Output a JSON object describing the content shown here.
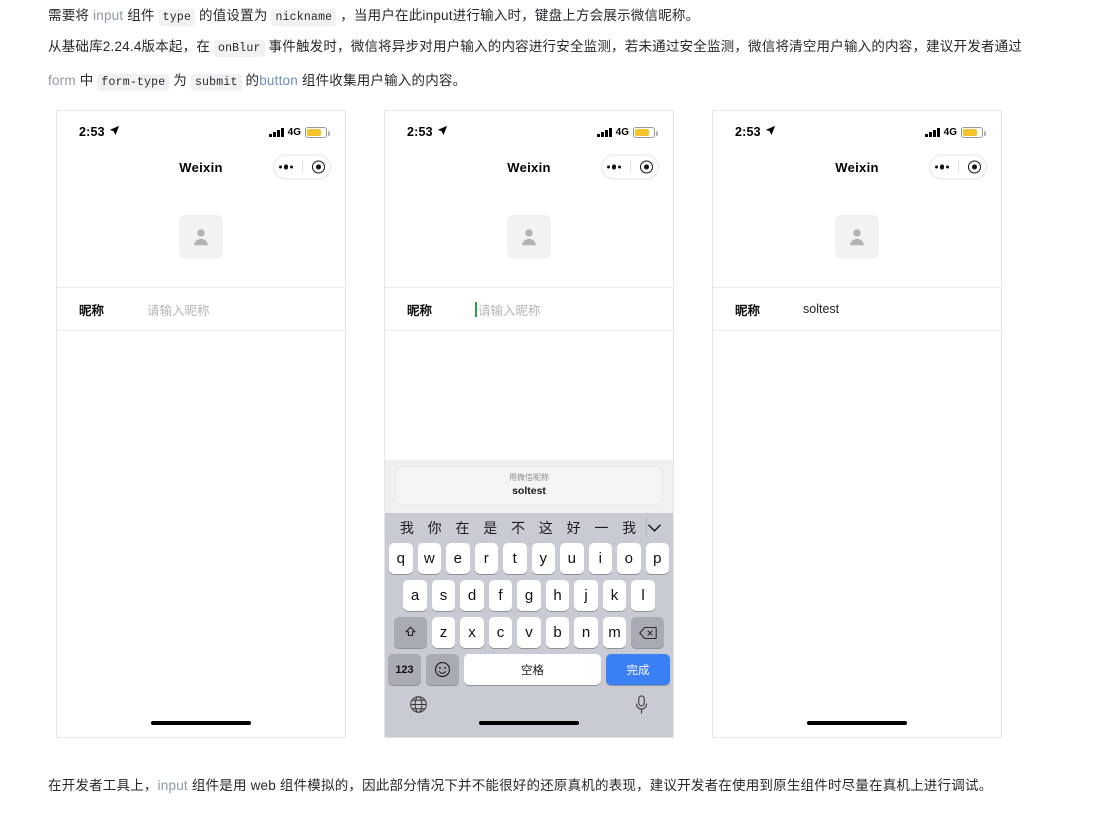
{
  "doc": {
    "paragraph1": {
      "seg1": "需要将 ",
      "code_input": "input",
      "seg2": " 组件 ",
      "code_type": "type",
      "seg3": " 的值设置为 ",
      "code_nickname": "nickname",
      "seg4": " ，当用户在此input进行输入时，键盘上方会展示微信昵称。"
    },
    "paragraph2": {
      "seg1": "从基础库2.24.4版本起，在 ",
      "code_onblur": "onBlur",
      "seg2": " 事件触发时，微信将异步对用户输入的内容进行安全监测，若未通过安全监测，微信将清空用户输入的内容，建议开发者通过 ",
      "code_form": "form",
      "seg3": " 中 ",
      "code_formtype": "form-type",
      "seg4": " 为 ",
      "code_submit": "submit",
      "seg5": " 的",
      "code_button": "button",
      "seg6": " 组件收集用户输入的内容。"
    },
    "paragraph3": {
      "seg1": "在开发者工具上，",
      "code_input": "input",
      "seg2": " 组件是用 web 组件模拟的，因此部分情况下并不能很好的还原真机的表现，建议开发者在使用到原生组件时尽量在真机上进行调试。"
    }
  },
  "phones": [
    {
      "id": "phone-initial",
      "status": {
        "time": "2:53",
        "network": "4G",
        "battery_level": "76"
      },
      "nav": {
        "title": "Weixin"
      },
      "form": {
        "label": "昵称",
        "value": "请输入昵称",
        "is_placeholder": true,
        "has_caret": false
      },
      "keyboard_visible": false
    },
    {
      "id": "phone-focused",
      "status": {
        "time": "2:53",
        "network": "4G",
        "battery_level": "76"
      },
      "nav": {
        "title": "Weixin"
      },
      "form": {
        "label": "昵称",
        "value": "请输入昵称",
        "is_placeholder": true,
        "has_caret": true
      },
      "keyboard_visible": true
    },
    {
      "id": "phone-filled",
      "status": {
        "time": "2:53",
        "network": "4G",
        "battery_level": "76"
      },
      "nav": {
        "title": "Weixin"
      },
      "form": {
        "label": "昵称",
        "value": "soltest",
        "is_placeholder": false,
        "has_caret": false
      },
      "keyboard_visible": false
    }
  ],
  "keyboard": {
    "suggestion": {
      "title": "用微信昵称",
      "value": "soltest"
    },
    "candidates": [
      "我",
      "你",
      "在",
      "是",
      "不",
      "这",
      "好",
      "一",
      "我"
    ],
    "expand_icon": "chevron-down-icon",
    "row1": [
      "q",
      "w",
      "e",
      "r",
      "t",
      "y",
      "u",
      "i",
      "o",
      "p"
    ],
    "row2": [
      "a",
      "s",
      "d",
      "f",
      "g",
      "h",
      "j",
      "k",
      "l"
    ],
    "row3": [
      "z",
      "x",
      "c",
      "v",
      "b",
      "n",
      "m"
    ],
    "shift_icon": "shift-icon",
    "backspace_icon": "backspace-icon",
    "numeric_label": "123",
    "emoji_icon": "emoji-icon",
    "space_label": "空格",
    "done_label": "完成",
    "globe_icon": "globe-icon",
    "mic_icon": "microphone-icon",
    "colors": {
      "done_blue": "#3b7ff5",
      "keyboard_bg": "#c9cbd4",
      "fn_key": "#a9abb4",
      "caret_green": "#2ba245"
    }
  }
}
